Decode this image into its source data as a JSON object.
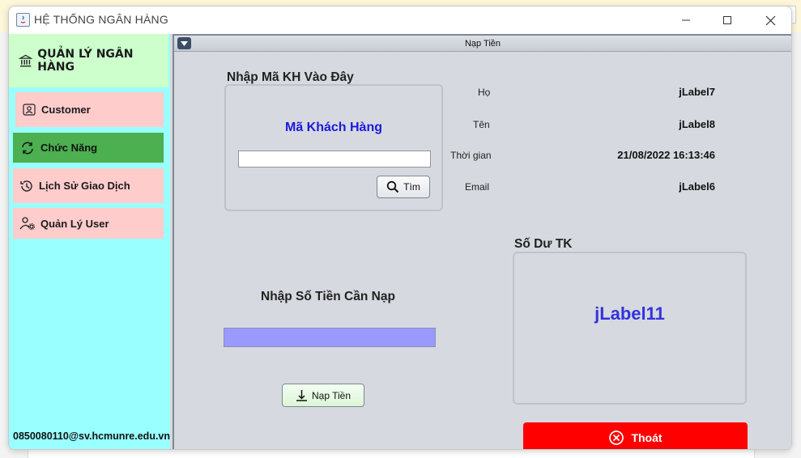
{
  "window": {
    "title": "HỆ THỐNG NGÂN HÀNG"
  },
  "sidebar": {
    "header": "QUẢN LÝ NGÂN HÀNG",
    "items": [
      {
        "label": "Customer",
        "icon": "customer-icon",
        "active": false
      },
      {
        "label": "Chức Năng",
        "icon": "refresh-icon",
        "active": true
      },
      {
        "label": "Lịch Sử Giao Dịch",
        "icon": "history-icon",
        "active": false
      },
      {
        "label": "Quản Lý User",
        "icon": "user-settings-icon",
        "active": false
      }
    ],
    "email": "0850080110@sv.hcmunre.edu.vn"
  },
  "frame": {
    "title": "Nạp Tiền"
  },
  "search": {
    "panel_title": "Nhập Mã KH Vào Đây",
    "field_label": "Mã Khách Hàng",
    "value": "",
    "button_label": "Tìm"
  },
  "info": {
    "ho_label": "Họ",
    "ho_value": "jLabel7",
    "ten_label": "Tên",
    "ten_value": "jLabel8",
    "time_label": "Thời gian",
    "time_value": "21/08/2022 16:13:46",
    "email_label": "Email",
    "email_value": "jLabel6"
  },
  "deposit": {
    "title": "Nhập Số Tiền Cần Nạp",
    "value": "",
    "button_label": "Nạp Tiền"
  },
  "balance": {
    "title": "Số Dư TK",
    "value": "jLabel11"
  },
  "exit": {
    "label": "Thoát"
  },
  "colors": {
    "sidebar_bg": "#99ffff",
    "sidebar_header_bg": "#ccffcc",
    "menu_item_bg": "#ffcccc",
    "menu_active_bg": "#4caf50",
    "amount_input_bg": "#9999ff",
    "exit_bg": "#ff0000",
    "accent_blue": "#1a1adb"
  }
}
